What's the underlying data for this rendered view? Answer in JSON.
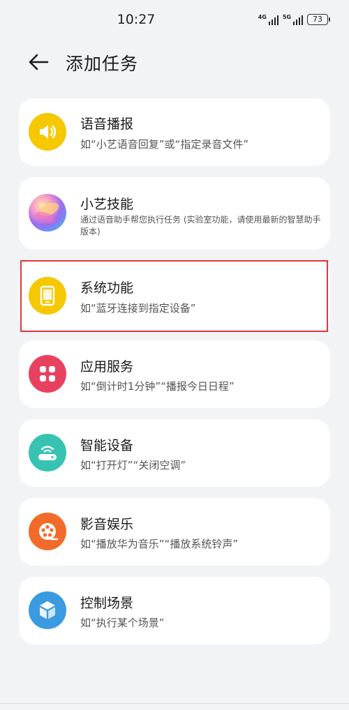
{
  "status": {
    "time": "10:27",
    "network1": "4G",
    "network2": "5G",
    "battery": "73"
  },
  "header": {
    "title": "添加任务",
    "back_icon": "arrow-left-icon"
  },
  "items": [
    {
      "title": "语音播报",
      "desc": "如“小艺语音回复”或“指定录音文件”",
      "icon": "speaker-icon",
      "color": "#f5c800"
    },
    {
      "title": "小艺技能",
      "desc": "通过语音助手帮您执行任务 (实验室功能，请使用最新的智慧助手版本)",
      "icon": "xiaoyi-orb-icon",
      "color": "#c56ad8"
    },
    {
      "title": "系统功能",
      "desc": "如“蓝牙连接到指定设备”",
      "icon": "tablet-icon",
      "color": "#f5c800"
    },
    {
      "title": "应用服务",
      "desc": "如“倒计时1分钟”“播报今日日程”",
      "icon": "apps-grid-icon",
      "color": "#e8415f"
    },
    {
      "title": "智能设备",
      "desc": "如“打开灯”“关闭空调”",
      "icon": "smart-device-icon",
      "color": "#36c3b2"
    },
    {
      "title": "影音娱乐",
      "desc": "如“播放华为音乐”“播放系统铃声”",
      "icon": "film-reel-icon",
      "color": "#f26b2a"
    },
    {
      "title": "控制场景",
      "desc": "如“执行某个场景”",
      "icon": "cube-icon",
      "color": "#3a9be0"
    }
  ],
  "highlight_color": "#e0383a"
}
